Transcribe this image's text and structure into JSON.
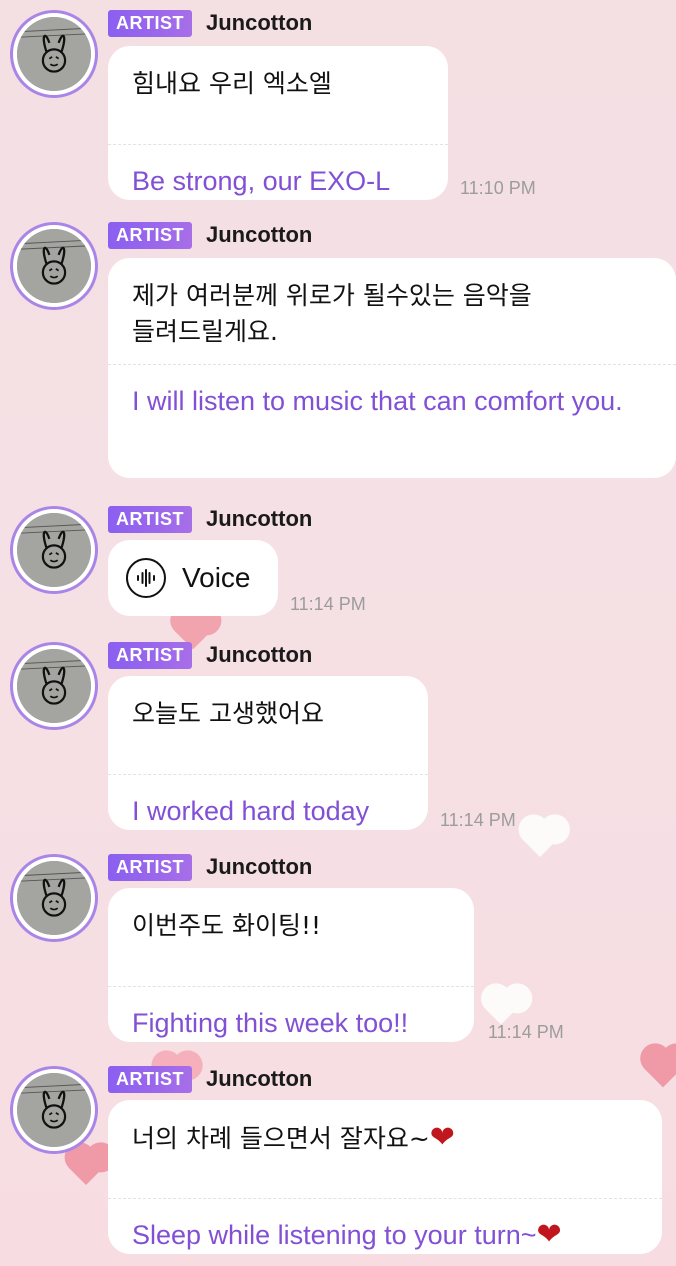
{
  "theme": {
    "accent": "#8a5ff0",
    "translation_color": "#8250d4",
    "timestamp_color": "#9c9c9c",
    "background": "#f5e1e5"
  },
  "messages": [
    {
      "badge": "ARTIST",
      "sender": "Juncotton",
      "korean": "힘내요 우리 엑소엘",
      "english": "Be strong, our EXO-L",
      "time": "11:10 PM"
    },
    {
      "badge": "ARTIST",
      "sender": "Juncotton",
      "korean": "제가 여러분께 위로가 될수있는 음악을 들려드릴게요.",
      "english": "I will listen to music that can comfort you.",
      "time": ""
    },
    {
      "badge": "ARTIST",
      "sender": "Juncotton",
      "voice_label": "Voice",
      "time": "11:14 PM"
    },
    {
      "badge": "ARTIST",
      "sender": "Juncotton",
      "korean": "오늘도 고생했어요",
      "english": "I worked hard today",
      "time": "11:14 PM"
    },
    {
      "badge": "ARTIST",
      "sender": "Juncotton",
      "korean": "이번주도 화이팅!!",
      "english": "Fighting this week too!!",
      "time": "11:14 PM"
    },
    {
      "badge": "ARTIST",
      "sender": "Juncotton",
      "korean": "너의 차례 들으면서 잘자요~",
      "english": "Sleep while listening to your turn~",
      "time": ""
    }
  ]
}
